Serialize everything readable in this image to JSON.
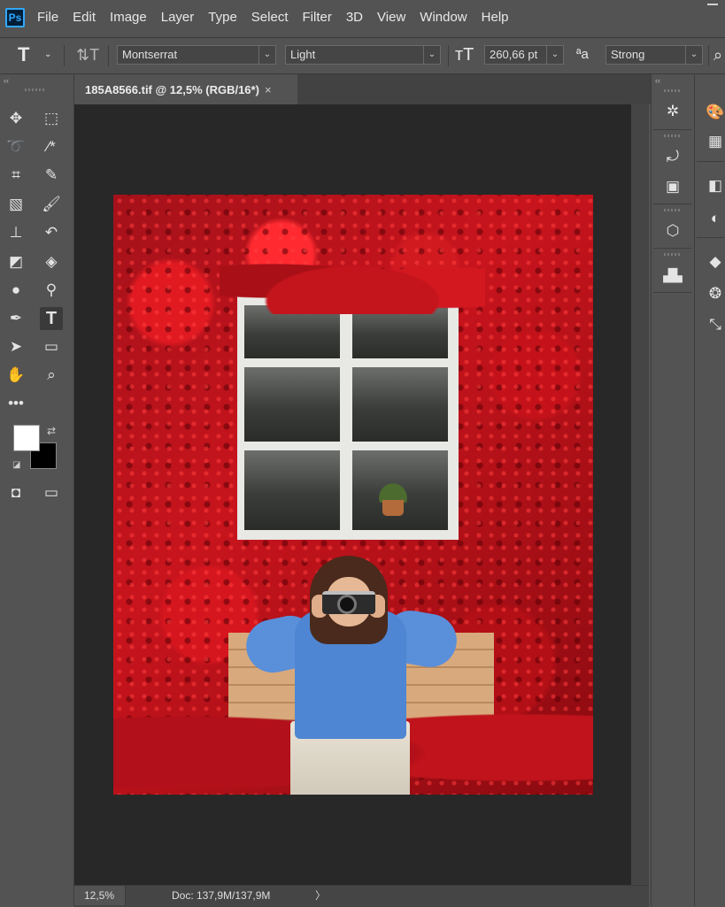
{
  "app": {
    "logo": "Ps"
  },
  "menu": [
    "File",
    "Edit",
    "Image",
    "Layer",
    "Type",
    "Select",
    "Filter",
    "3D",
    "View",
    "Window",
    "Help"
  ],
  "options": {
    "font_family": "Montserrat",
    "font_style": "Light",
    "font_size": "260,66 pt",
    "antialias": "Strong",
    "antialias_icon_label": "ªa"
  },
  "document": {
    "tab_title": "185A8566.tif @ 12,5% (RGB/16*)",
    "close_glyph": "×"
  },
  "status": {
    "zoom": "12,5%",
    "doc_info": "Doc: 137,9M/137,9M",
    "arrow": "〉"
  },
  "colors": {
    "foreground": "#ffffff",
    "background": "#000000"
  },
  "icons": {
    "tools": [
      "move-icon",
      "marquee-icon",
      "lasso-icon",
      "magic-wand-icon",
      "crop-icon",
      "eyedropper-icon",
      "healing-brush-icon",
      "brush-icon",
      "clone-stamp-icon",
      "history-brush-icon",
      "eraser-icon",
      "paint-bucket-icon",
      "blur-icon",
      "dodge-icon",
      "pen-icon",
      "type-icon",
      "path-selection-icon",
      "rectangle-icon",
      "hand-icon",
      "zoom-icon",
      "more-tools-icon",
      "quick-mask-icon",
      "screen-mode-icon"
    ],
    "panels": [
      "navigator-icon",
      "history-icon",
      "actions-icon",
      "3d-icon",
      "histogram-icon",
      "color-icon",
      "swatches-icon",
      "libraries-icon",
      "adjustments-icon",
      "layers-icon",
      "channels-icon",
      "paths-icon"
    ]
  }
}
